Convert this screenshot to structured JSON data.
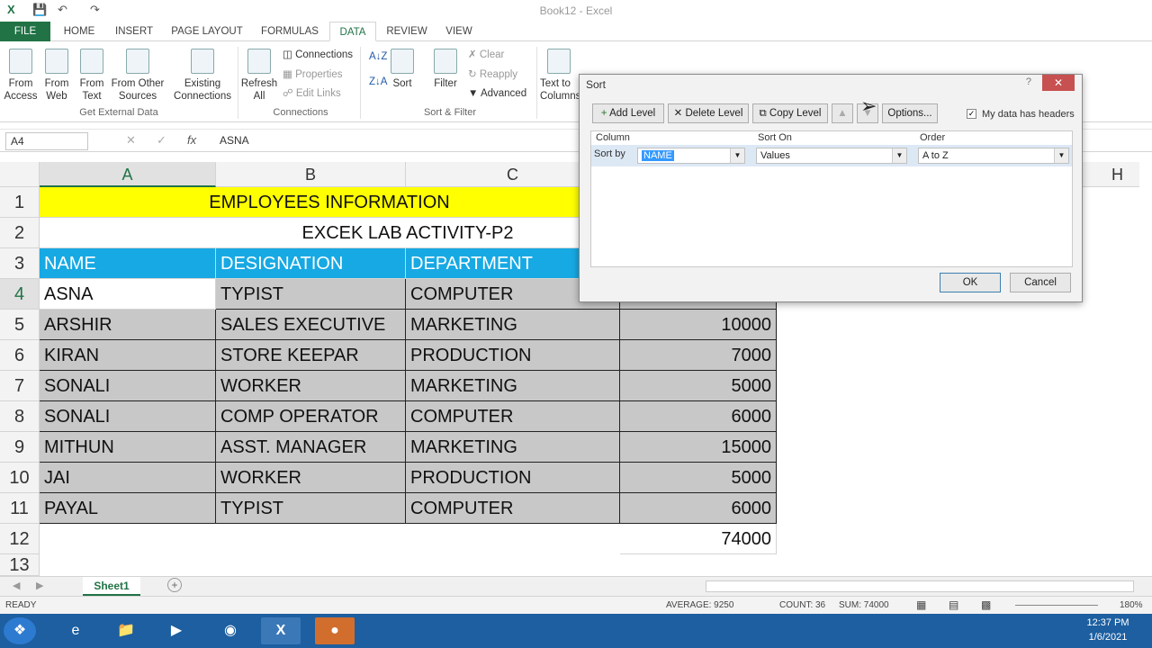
{
  "window": {
    "title": "Book12 - Excel"
  },
  "tabs": [
    "FILE",
    "HOME",
    "INSERT",
    "PAGE LAYOUT",
    "FORMULAS",
    "DATA",
    "REVIEW",
    "VIEW"
  ],
  "active_tab": "DATA",
  "ribbon": {
    "external": {
      "from_access": "From Access",
      "from_web": "From Web",
      "from_text": "From Text",
      "from_other": "From Other Sources",
      "existing": "Existing Connections",
      "group": "Get External Data"
    },
    "connections": {
      "refresh": "Refresh All",
      "connections": "Connections",
      "properties": "Properties",
      "edit_links": "Edit Links",
      "group": "Connections"
    },
    "sortfilter": {
      "sort": "Sort",
      "filter": "Filter",
      "clear": "Clear",
      "reapply": "Reapply",
      "advanced": "Advanced",
      "group": "Sort & Filter"
    },
    "tools": {
      "text_to_columns": "Text to Columns"
    }
  },
  "formula_bar": {
    "name_box": "A4",
    "formula": "ASNA"
  },
  "columns": [
    "A",
    "B",
    "C",
    "H"
  ],
  "rows": [
    "1",
    "2",
    "3",
    "4",
    "5",
    "6",
    "7",
    "8",
    "9",
    "10",
    "11",
    "12",
    "13"
  ],
  "sheet": {
    "title": "EMPLOYEES INFORMATION",
    "subtitle": "EXCEK LAB ACTIVITY-P2",
    "headers": [
      "NAME",
      "DESIGNATION",
      "DEPARTMENT"
    ],
    "data": [
      [
        "ASNA",
        "TYPIST",
        "COMPUTER",
        ""
      ],
      [
        "ARSHIR",
        "SALES EXECUTIVE",
        "MARKETING",
        "10000"
      ],
      [
        "KIRAN",
        "STORE KEEPAR",
        "PRODUCTION",
        "7000"
      ],
      [
        "SONALI",
        "WORKER",
        "MARKETING",
        "5000"
      ],
      [
        "SONALI",
        "COMP OPERATOR",
        "COMPUTER",
        "6000"
      ],
      [
        "MITHUN",
        "ASST.  MANAGER",
        "MARKETING",
        "15000"
      ],
      [
        "JAI",
        "WORKER",
        "PRODUCTION",
        "5000"
      ],
      [
        "PAYAL",
        "TYPIST",
        "COMPUTER",
        "6000"
      ]
    ],
    "total": "74000"
  },
  "dialog": {
    "title": "Sort",
    "add_level": "Add Level",
    "delete_level": "Delete Level",
    "copy_level": "Copy Level",
    "options": "Options...",
    "headers_check": "My data has headers",
    "col_header": "Column",
    "sorton_header": "Sort On",
    "order_header": "Order",
    "sort_by": "Sort by",
    "column_value": "NAME",
    "sorton_value": "Values",
    "order_value": "A to Z",
    "ok": "OK",
    "cancel": "Cancel"
  },
  "sheet_tab": "Sheet1",
  "status": {
    "ready": "READY",
    "average": "AVERAGE: 9250",
    "count": "COUNT: 36",
    "sum": "SUM: 74000",
    "zoom": "180%"
  },
  "clock": {
    "time": "12:37 PM",
    "date": "1/6/2021"
  },
  "colors": {
    "excel_green": "#217346",
    "title_yellow": "#ffff00",
    "header_blue": "#17a9e3",
    "selection_gray": "#c8c8c8"
  }
}
